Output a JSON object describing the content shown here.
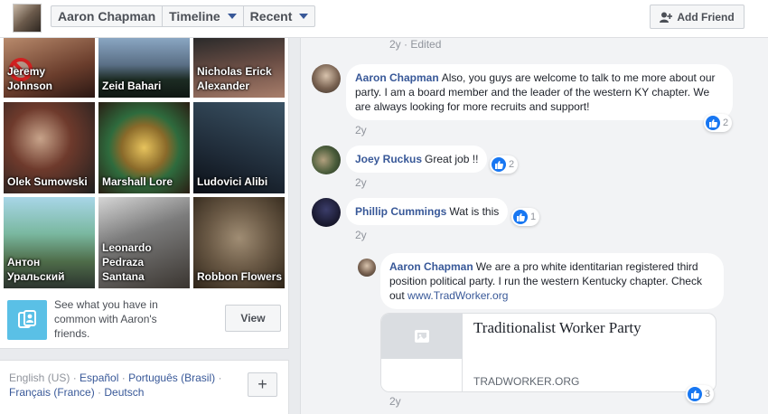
{
  "header": {
    "profile_name": "Aaron Chapman",
    "timeline_label": "Timeline",
    "recent_label": "Recent",
    "add_friend_label": "Add Friend"
  },
  "friends": [
    {
      "name": "Jeremy Johnson"
    },
    {
      "name": "Zeid Bahari"
    },
    {
      "name": "Nicholas Erick Alexander"
    },
    {
      "name": "Olek Sumowski"
    },
    {
      "name": "Marshall Lore"
    },
    {
      "name": "Ludovici Alibi"
    },
    {
      "name": "Антон Уральский"
    },
    {
      "name": "Leonardo Pedraza Santana"
    },
    {
      "name": "Robbon Flowers"
    }
  ],
  "common": {
    "text": "See what you have in common with Aaron's friends.",
    "view_label": "View"
  },
  "languages": {
    "current": "English (US)",
    "espanol": "Español",
    "portugues": "Português (Brasil)",
    "francais": "Français (France)",
    "deutsch": "Deutsch",
    "plus_label": "+"
  },
  "comments": {
    "top_meta": {
      "time": "2y",
      "sep": "·",
      "edited": "Edited"
    },
    "c1": {
      "author": "Aaron Chapman",
      "text": "Also, you guys are welcome to talk to me more about our party. I am a board member and the leader of the western KY chapter. We are always looking for more recruits and support!",
      "likes": "2",
      "time": "2y"
    },
    "c2": {
      "author": "Joey Ruckus",
      "text": "Great job !!",
      "likes": "2",
      "time": "2y"
    },
    "c3": {
      "author": "Phillip Cummings",
      "text": "Wat is this",
      "likes": "1",
      "time": "2y"
    },
    "c4": {
      "author": "Aaron Chapman",
      "text": "We are a pro white identitarian registered third position political party. I run the western Kentucky chapter. Check out",
      "link_text": "www.TradWorker.org",
      "likes": "3",
      "time": "2y"
    }
  },
  "link_preview": {
    "title": "Traditionalist Worker Party",
    "domain": "TRADWORKER.ORG"
  },
  "colors": {
    "link": "#385898",
    "like_blue": "#1877f2",
    "bg": "#e9ebee"
  }
}
